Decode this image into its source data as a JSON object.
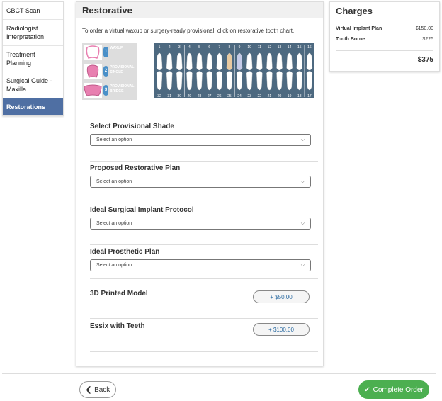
{
  "sidebar": {
    "items": [
      {
        "label": "CBCT Scan"
      },
      {
        "label": "Radiologist Interpretation"
      },
      {
        "label": "Treatment Planning"
      },
      {
        "label": "Surgical Guide - Maxilla"
      },
      {
        "label": "Restorations"
      }
    ]
  },
  "main": {
    "title": "Restorative",
    "instruction": "To order a virtual waxup or surgery-ready provisional, click on restorative tooth chart.",
    "legend": [
      {
        "num": "1",
        "text": "WAXUP"
      },
      {
        "num": "2",
        "text": "PROVISIONAL SINGLE"
      },
      {
        "num": "3",
        "text": "PROVISIONAL BRIDGE"
      }
    ],
    "tooth_numbers_top": [
      "1",
      "2",
      "3",
      "4",
      "5",
      "6",
      "7",
      "8",
      "9",
      "10",
      "11",
      "12",
      "13",
      "14",
      "15",
      "16"
    ],
    "tooth_numbers_bottom": [
      "32",
      "31",
      "30",
      "29",
      "28",
      "27",
      "26",
      "25",
      "24",
      "23",
      "22",
      "21",
      "20",
      "19",
      "18",
      "17"
    ],
    "sections": [
      {
        "label": "Select Provisional Shade",
        "select": "Select an option"
      },
      {
        "label": "Proposed Restorative Plan",
        "select": "Select an option"
      },
      {
        "label": "Ideal Surgical Implant Protocol",
        "select": "Select an option"
      },
      {
        "label": "Ideal Prosthetic Plan",
        "select": "Select an option"
      }
    ],
    "addons": [
      {
        "label": "3D Printed Model",
        "price": "$50.00"
      },
      {
        "label": "Essix with Teeth",
        "price": "$100.00"
      }
    ]
  },
  "charges": {
    "title": "Charges",
    "rows": [
      {
        "label": "Virtual Implant Plan",
        "value": "$150.00"
      },
      {
        "label": "Tooth Borne",
        "value": "$225"
      }
    ],
    "total": "$375"
  },
  "footer": {
    "back_label": "Back",
    "complete_label": "Complete Order"
  },
  "colors": {
    "active_nav": "#4f6fa3",
    "chart_bg": "#4d6980",
    "complete_green": "#4caf50",
    "legend_badge": "#4a90c8",
    "legend_pink": "#e87fb0"
  }
}
